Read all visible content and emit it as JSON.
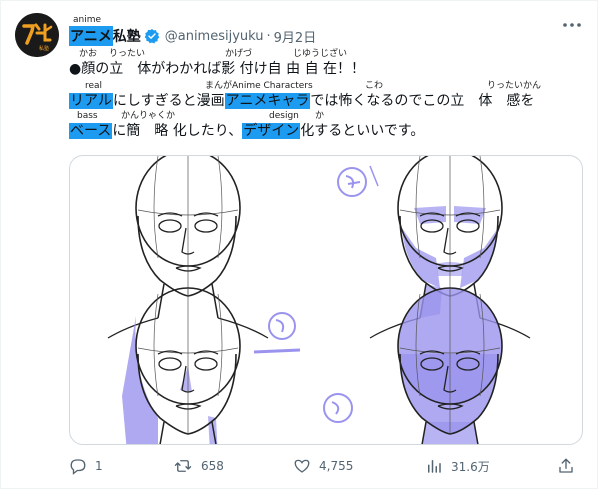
{
  "account": {
    "ruby": "anime",
    "name_highlight": "アニメ",
    "name_rest": "私塾",
    "handle": "@animesijyuku",
    "separator": "·",
    "date": "9月2日"
  },
  "tweet": {
    "line1": {
      "ruby_1": "かお",
      "ruby_2": "りったい",
      "ruby_3": "かげづ",
      "ruby_4": "じゆうじざい",
      "text": "●顔の立　体がわかれば影 付け自 由 自 在！！"
    },
    "line2": {
      "ruby_1": "real",
      "ruby_2": "まんがAnime Characters",
      "ruby_3": "こわ",
      "ruby_4": "りったいかん",
      "hl_1": "リアル",
      "text_1": "にしすぎると漫画",
      "hl_2": "アニメキャラ",
      "text_2": "では怖くなるのでこの立　体　感を"
    },
    "line3": {
      "ruby_1": "bass",
      "ruby_2": "かんりゃくか",
      "ruby_3": "design",
      "ruby_4": "か",
      "hl_1": "ベース",
      "text_1": "に簡　略 化したり、",
      "hl_2": "デザイン",
      "text_2": "化するといいです。"
    }
  },
  "media": {
    "alt_icon": "face-sketch-illustration",
    "shade_color": "#9a94ee"
  },
  "stats": {
    "replies": "1",
    "retweets": "658",
    "likes": "4,755",
    "views": "31.6万"
  },
  "colors": {
    "highlight": "#1d9bf0",
    "muted": "#536471",
    "verified": "#1d9bf0"
  }
}
